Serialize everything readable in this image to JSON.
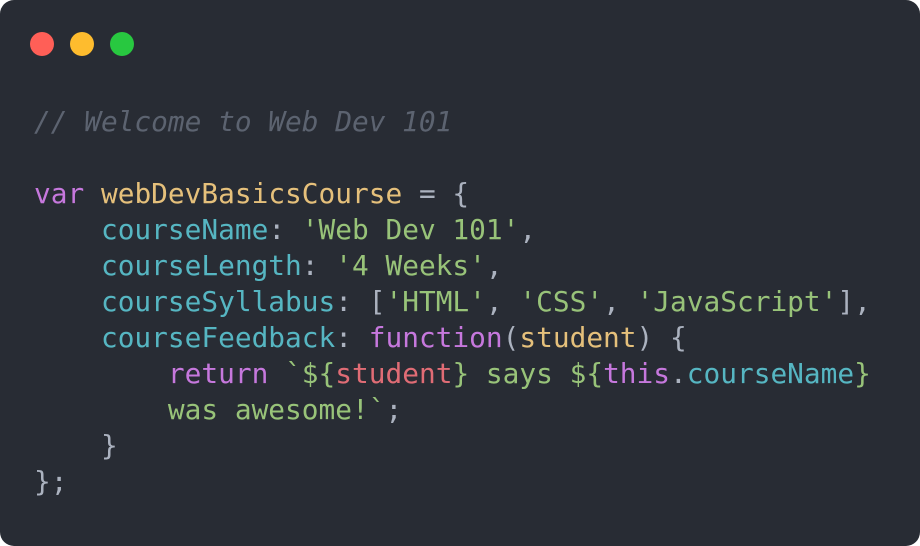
{
  "window": {
    "controls": {
      "close_color": "#ff5f57",
      "minimize_color": "#febc2e",
      "maximize_color": "#28c840"
    }
  },
  "code": {
    "comment": "// Welcome to Web Dev 101",
    "line_var": {
      "keyword": "var",
      "name": "webDevBasicsCourse",
      "op": " = {"
    },
    "line_name": {
      "prop": "courseName",
      "colon": ": ",
      "value": "'Web Dev 101'",
      "end": ","
    },
    "line_length": {
      "prop": "courseLength",
      "colon": ": ",
      "value": "'4 Weeks'",
      "end": ","
    },
    "line_syllabus": {
      "prop": "courseSyllabus",
      "colon": ": ",
      "open": "[",
      "item1": "'HTML'",
      "sep1": ", ",
      "item2": "'CSS'",
      "sep2": ", ",
      "item3": "'JavaScript'",
      "close": "],"
    },
    "line_feedback": {
      "prop": "courseFeedback",
      "colon": ": ",
      "keyword": "function",
      "open": "(",
      "param": "student",
      "close": ") {"
    },
    "line_return": {
      "keyword": "return",
      "tick_open": "`${",
      "interp_var": "student",
      "mid": "} says ${",
      "this": "this",
      "dot": ".",
      "interp_prop": "courseName",
      "brace_close": "}"
    },
    "line_return_cont": {
      "text": "was awesome!`",
      "end": ";"
    },
    "line_inner_close": "}",
    "line_outer_close": "};"
  }
}
